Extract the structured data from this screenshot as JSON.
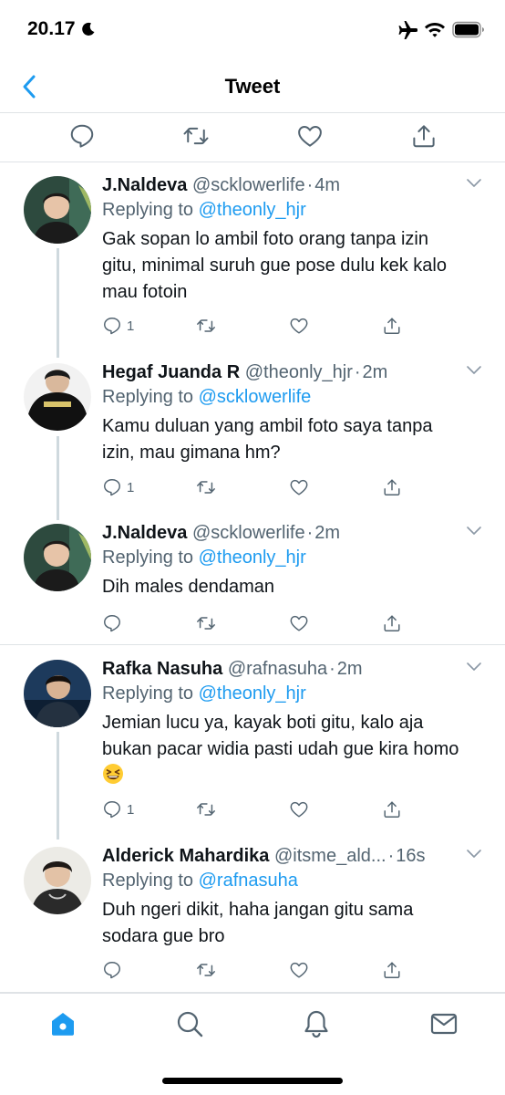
{
  "status_bar": {
    "time": "20.17"
  },
  "nav": {
    "title": "Tweet"
  },
  "colors": {
    "accent": "#1d9bf0",
    "text": "#0f1419",
    "muted": "#536471",
    "divider": "#dfe3e6"
  },
  "main_actions": [
    "reply-icon",
    "retweet-icon",
    "like-icon",
    "share-icon"
  ],
  "replies": [
    {
      "name": "J.Naldeva",
      "handle": "@scklowerlife",
      "dot": "·",
      "time": "4m",
      "replying_prefix": "Replying to ",
      "replying_to": "@theonly_hjr",
      "text": "Gak sopan lo ambil foto orang tanpa izin gitu, minimal suruh gue pose dulu kek kalo mau fotoin",
      "reply_count": "1"
    },
    {
      "name": "Hegaf Juanda R",
      "handle": "@theonly_hjr",
      "dot": "·",
      "time": "2m",
      "replying_prefix": "Replying to ",
      "replying_to": "@scklowerlife",
      "text": "Kamu duluan yang ambil foto saya tanpa izin, mau gimana hm?",
      "reply_count": "1"
    },
    {
      "name": "J.Naldeva",
      "handle": "@scklowerlife",
      "dot": "·",
      "time": "2m",
      "replying_prefix": "Replying to ",
      "replying_to": "@theonly_hjr",
      "text": "Dih males dendaman",
      "reply_count": ""
    },
    {
      "name": "Rafka Nasuha",
      "handle": "@rafnasuha",
      "dot": "·",
      "time": "2m",
      "replying_prefix": "Replying to ",
      "replying_to": "@theonly_hjr",
      "text": "Jemian lucu ya, kayak boti gitu, kalo aja bukan pacar widia pasti udah gue kira homo",
      "emoji": "grinning-squinting-face-emoji",
      "reply_count": "1"
    },
    {
      "name": "Alderick Mahardika",
      "handle": "@itsme_ald...",
      "dot": "·",
      "time": "16s",
      "replying_prefix": "Replying to ",
      "replying_to": "@rafnasuha",
      "text": "Duh ngeri dikit, haha jangan gitu sama sodara gue bro",
      "reply_count": ""
    }
  ],
  "tabs": [
    "home-icon",
    "search-icon",
    "notifications-icon",
    "messages-icon"
  ]
}
